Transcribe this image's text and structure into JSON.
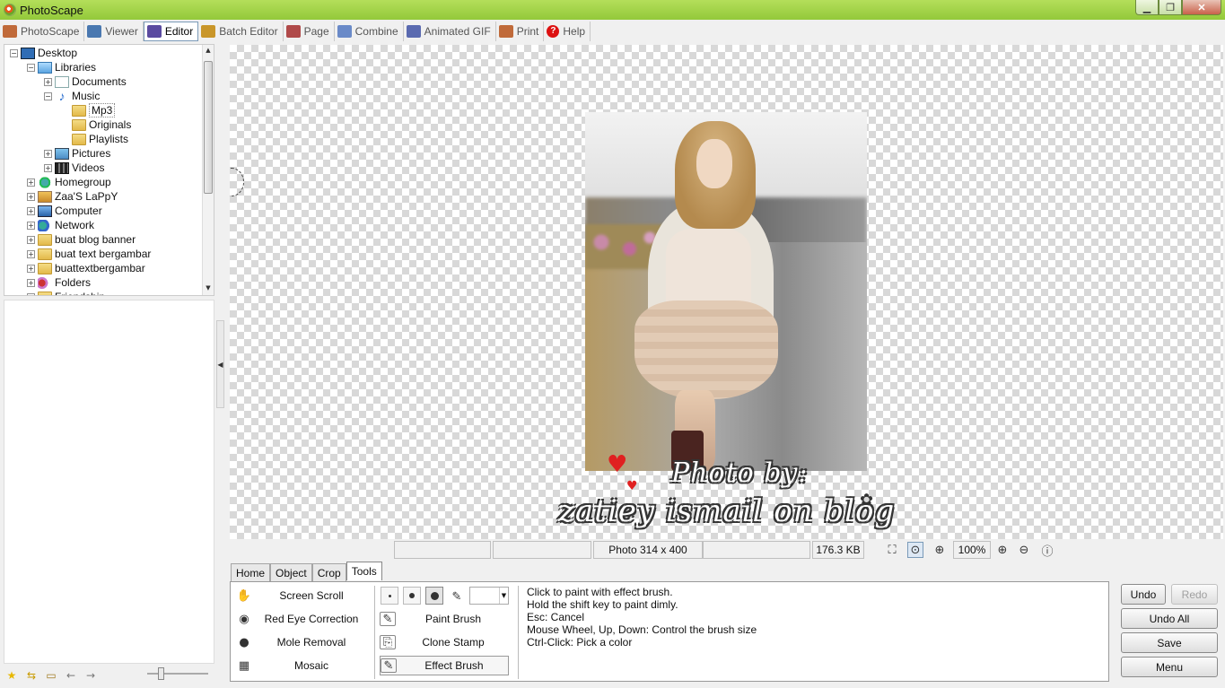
{
  "window": {
    "title": "PhotoScape",
    "minimize": "▁",
    "maximize": "❐",
    "close": "✕"
  },
  "main_tabs": [
    {
      "label": "PhotoScape",
      "color": "#c06a3a"
    },
    {
      "label": "Viewer",
      "color": "#4a78b0"
    },
    {
      "label": "Editor",
      "color": "#5a4aa0"
    },
    {
      "label": "Batch Editor",
      "color": "#c9962a"
    },
    {
      "label": "Page",
      "color": "#b04a4a"
    },
    {
      "label": "Combine",
      "color": "#6a8ac8"
    },
    {
      "label": "Animated GIF",
      "color": "#5a6ab0"
    },
    {
      "label": "Print",
      "color": "#c06a3a"
    },
    {
      "label": "Help",
      "color": "#dd1111"
    }
  ],
  "active_tab": "Editor",
  "tree": {
    "items": [
      {
        "label": "Desktop",
        "icon": "desktop-icon"
      },
      {
        "label": "Libraries",
        "icon": "libraries-icon"
      },
      {
        "label": "Documents",
        "icon": "documents-icon"
      },
      {
        "label": "Music",
        "icon": "music-icon"
      },
      {
        "label": "Mp3",
        "icon": "folder-icon"
      },
      {
        "label": "Originals",
        "icon": "folder-icon"
      },
      {
        "label": "Playlists",
        "icon": "folder-icon"
      },
      {
        "label": "Pictures",
        "icon": "pictures-icon"
      },
      {
        "label": "Videos",
        "icon": "videos-icon"
      },
      {
        "label": "Homegroup",
        "icon": "homegroup-icon"
      },
      {
        "label": "Zaa'S LaPpY",
        "icon": "user-icon"
      },
      {
        "label": "Computer",
        "icon": "computer-icon"
      },
      {
        "label": "Network",
        "icon": "network-icon"
      },
      {
        "label": "buat blog banner",
        "icon": "folder-icon"
      },
      {
        "label": "buat text bergambar",
        "icon": "folder-icon"
      },
      {
        "label": "buattextbergambar",
        "icon": "folder-icon"
      },
      {
        "label": "Folders",
        "icon": "folders-icon"
      },
      {
        "label": "Friendship",
        "icon": "folder-icon"
      }
    ],
    "selected": "Mp3"
  },
  "canvas": {
    "watermark_line1": "Photo by:",
    "watermark_line2": "zatiey ismail on blog"
  },
  "status": {
    "photo_size": "Photo 314 x 400",
    "file_size": "176.3 KB",
    "zoom": "100%"
  },
  "bottom_tabs": [
    "Home",
    "Object",
    "Crop",
    "Tools"
  ],
  "active_bottom_tab": "Tools",
  "tools_left": [
    {
      "label": "Screen Scroll",
      "icon": "hand-icon"
    },
    {
      "label": "Red Eye Correction",
      "icon": "eye-icon"
    },
    {
      "label": "Mole Removal",
      "icon": "mole-icon"
    },
    {
      "label": "Mosaic",
      "icon": "mosaic-icon"
    }
  ],
  "tools_right": [
    {
      "label": "Paint Brush",
      "icon": "paint-brush-icon"
    },
    {
      "label": "Clone Stamp",
      "icon": "clone-stamp-icon"
    },
    {
      "label": "Effect Brush",
      "icon": "effect-brush-icon"
    }
  ],
  "help_text": [
    "Click to paint with effect brush.",
    "Hold the shift key to paint dimly.",
    "Esc: Cancel",
    "Mouse Wheel, Up, Down: Control the brush size",
    "Ctrl-Click: Pick a color"
  ],
  "actions": {
    "undo": "Undo",
    "redo": "Redo",
    "undo_all": "Undo All",
    "save": "Save",
    "menu": "Menu"
  }
}
